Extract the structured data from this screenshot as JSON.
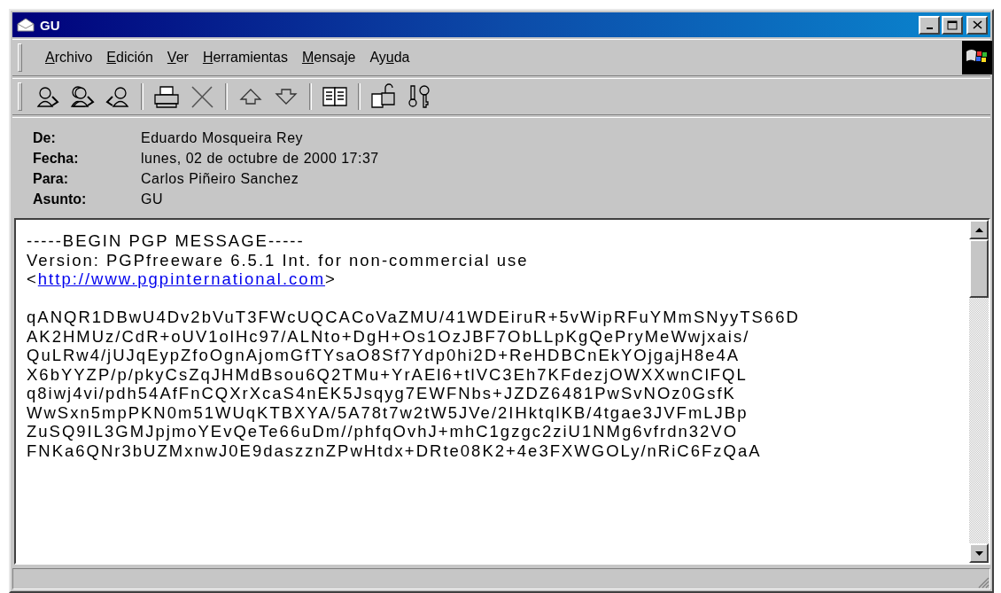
{
  "window": {
    "title": "GU"
  },
  "menu": [
    {
      "key": "A",
      "post": "rchivo"
    },
    {
      "key": "E",
      "post": "dición"
    },
    {
      "key": "V",
      "post": "er"
    },
    {
      "key": "H",
      "post": "erramientas"
    },
    {
      "key": "M",
      "post": "ensaje"
    },
    {
      "pre": "Ay",
      "key": "u",
      "post": "da"
    }
  ],
  "toolbar": [
    {
      "kind": "reply"
    },
    {
      "kind": "reply-all"
    },
    {
      "kind": "forward"
    },
    {
      "kind": "separator"
    },
    {
      "kind": "print"
    },
    {
      "kind": "delete"
    },
    {
      "kind": "separator"
    },
    {
      "kind": "up"
    },
    {
      "kind": "down"
    },
    {
      "kind": "separator"
    },
    {
      "kind": "book"
    },
    {
      "kind": "separator"
    },
    {
      "kind": "decrypt"
    },
    {
      "kind": "keys"
    }
  ],
  "headers": [
    {
      "label": "De:",
      "value": "Eduardo Mosqueira Rey"
    },
    {
      "label": "Fecha:",
      "value": "lunes, 02 de octubre de 2000 17:37"
    },
    {
      "label": "Para:",
      "value": "Carlos Piñeiro Sanchez"
    },
    {
      "label": "Asunto:",
      "value": "GU"
    }
  ],
  "body": [
    {
      "kind": "text",
      "text": "-----BEGIN PGP MESSAGE-----"
    },
    {
      "kind": "text",
      "text": "Version: PGPfreeware 6.5.1 Int. for non-commercial use"
    },
    {
      "kind": "link",
      "pre": "<",
      "link": "http://www.pgpinternational.com",
      "post": ">"
    },
    {
      "kind": "blank"
    },
    {
      "kind": "text",
      "text": "qANQR1DBwU4Dv2bVuT3FWcUQCACoVaZMU/41WDEiruR+5vWipRFuYMmSNyyTS66D"
    },
    {
      "kind": "text",
      "text": "AK2HMUz/CdR+oUV1olHc97/ALNto+DgH+Os1OzJBF7ObLLpKgQePryMeWwjxais/"
    },
    {
      "kind": "text",
      "text": "QuLRw4/jUJqEypZfoOgnAjomGfTYsaO8Sf7Ydp0hi2D+ReHDBCnEkYOjgajH8e4A"
    },
    {
      "kind": "text",
      "text": "X6bYYZP/p/pkyCsZqJHMdBsou6Q2TMu+YrAEl6+tlVC3Eh7KFdezjOWXXwnClFQL"
    },
    {
      "kind": "text",
      "text": "q8iwj4vi/pdh54AfFnCQXrXcaS4nEK5Jsqyg7EWFNbs+JZDZ6481PwSvNOz0GsfK"
    },
    {
      "kind": "text",
      "text": "WwSxn5mpPKN0m51WUqKTBXYA/5A78t7w2tW5JVe/2IHktqlKB/4tgae3JVFmLJBp"
    },
    {
      "kind": "text",
      "text": "ZuSQ9IL3GMJpjmoYEvQeTe66uDm//phfqOvhJ+mhC1gzgc2ziU1NMg6vfrdn32VO"
    },
    {
      "kind": "text",
      "text": "FNKa6QNr3bUZMxnwJ0E9daszznZPwHtdx+DRte08K2+4e3FXWGOLy/nRiC6FzQaA"
    }
  ]
}
